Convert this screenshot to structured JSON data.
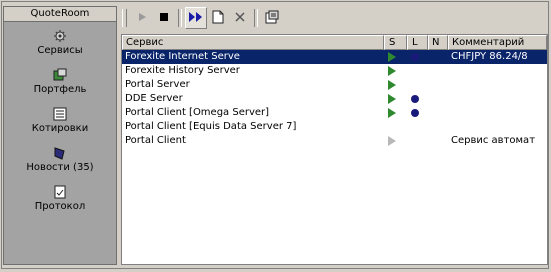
{
  "sidebar": {
    "title": "QuoteRoom",
    "items": [
      {
        "label": "Сервисы",
        "icon": "services-icon"
      },
      {
        "label": "Портфель",
        "icon": "portfolio-icon"
      },
      {
        "label": "Котировки",
        "icon": "quotes-icon"
      },
      {
        "label": "Новости (35)",
        "icon": "news-icon"
      },
      {
        "label": "Протокол",
        "icon": "protocol-icon"
      }
    ]
  },
  "toolbar": {
    "buttons": [
      "play-icon",
      "stop-icon",
      "fast-forward-icon",
      "new-document-icon",
      "delete-icon",
      "properties-icon"
    ]
  },
  "table": {
    "headers": [
      "Сервис",
      "S",
      "L",
      "N",
      "Комментарий"
    ],
    "rows": [
      {
        "name": "Forexite Internet Serve",
        "s": "running",
        "l": "dot",
        "comment": "CHFJPY 86.24/8",
        "selected": true
      },
      {
        "name": "Forexite History Server",
        "s": "running",
        "l": "",
        "comment": "",
        "selected": false
      },
      {
        "name": "Portal Server",
        "s": "running",
        "l": "",
        "comment": "",
        "selected": false
      },
      {
        "name": "DDE Server",
        "s": "running",
        "l": "dot",
        "comment": "",
        "selected": false
      },
      {
        "name": "Portal Client [Omega Server]",
        "s": "running",
        "l": "dot",
        "comment": "",
        "selected": false
      },
      {
        "name": "Portal Client [Equis Data Server 7]",
        "s": "",
        "l": "",
        "comment": "",
        "selected": false
      },
      {
        "name": "Portal Client",
        "s": "stopped",
        "l": "",
        "comment": "Сервис автомат",
        "selected": false
      }
    ]
  },
  "colors": {
    "selection": "#0a246a",
    "play": "#2f8a2f",
    "dot": "#1a1a7a"
  }
}
